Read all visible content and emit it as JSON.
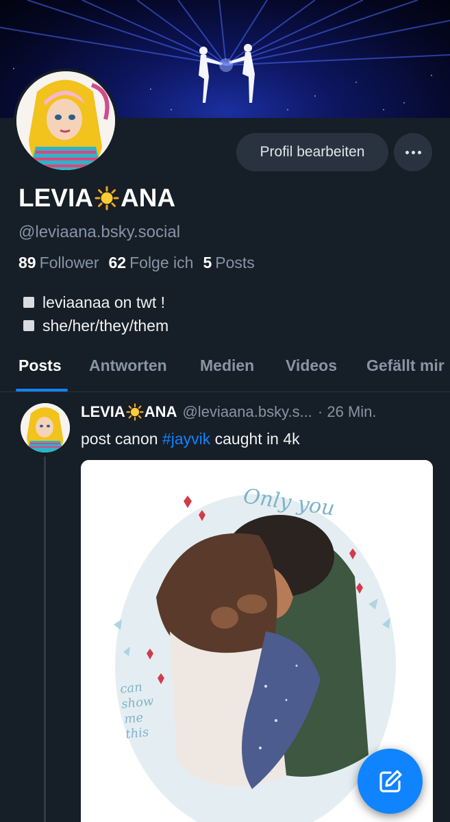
{
  "profile": {
    "name_part1": "LEVIA",
    "name_part2": "ANA",
    "handle": "@leviaana.bsky.social",
    "edit_button": "Profil bearbeiten",
    "stats": {
      "followers_count": "89",
      "followers_label": "Follower",
      "following_count": "62",
      "following_label": "Folge ich",
      "posts_count": "5",
      "posts_label": "Posts"
    },
    "bio": [
      "leviaanaa on twt !",
      "she/her/they/them"
    ]
  },
  "tabs": [
    "Posts",
    "Antworten",
    "Medien",
    "Videos",
    "Gefällt mir"
  ],
  "post": {
    "author_part1": "LEVIA",
    "author_part2": "ANA",
    "handle": "@leviaana.bsky.s...",
    "time": "· 26 Min.",
    "text_before": "post canon ",
    "hashtag": "#jayvik",
    "text_after": " caught in 4k"
  },
  "colors": {
    "background": "#161e27",
    "accent": "#1083fe",
    "muted_text": "#8795a6"
  },
  "icons": {
    "more": "more-horizontal-icon",
    "compose": "compose-icon",
    "sun_emoji": "sun-emoji-icon"
  }
}
